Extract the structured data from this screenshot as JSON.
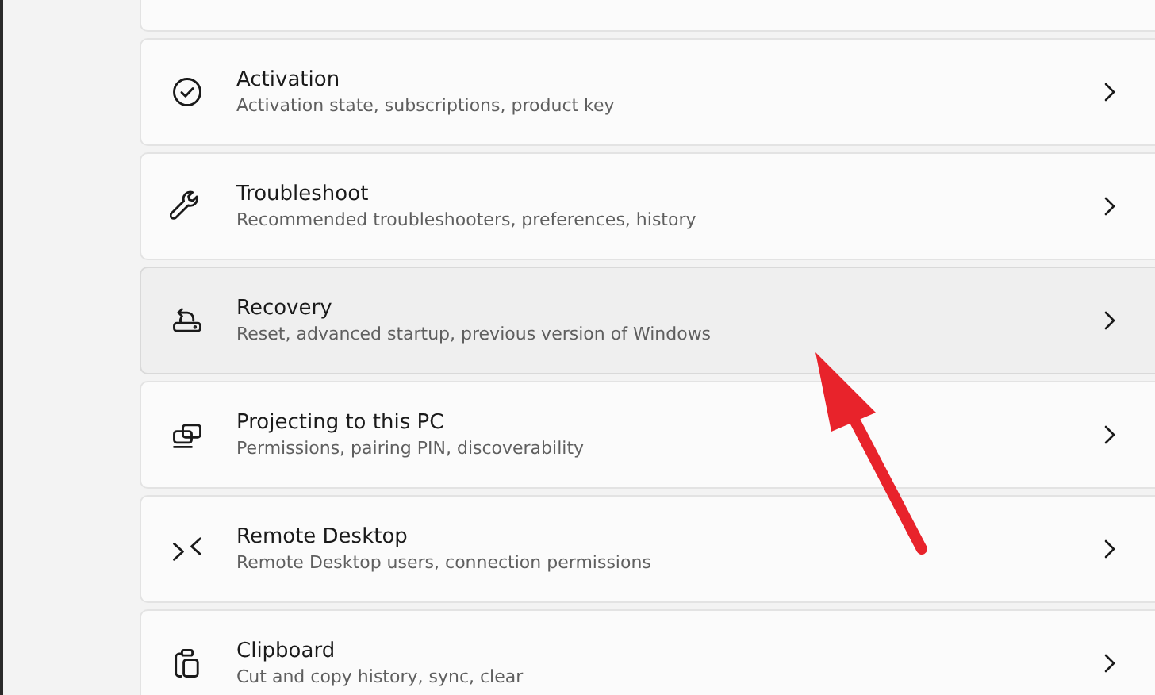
{
  "items": [
    {
      "kind": "activation",
      "title": "Activation",
      "subtitle": "Activation state, subscriptions, product key",
      "highlighted": false
    },
    {
      "kind": "troubleshoot",
      "title": "Troubleshoot",
      "subtitle": "Recommended troubleshooters, preferences, history",
      "highlighted": false
    },
    {
      "kind": "recovery",
      "title": "Recovery",
      "subtitle": "Reset, advanced startup, previous version of Windows",
      "highlighted": true
    },
    {
      "kind": "projecting",
      "title": "Projecting to this PC",
      "subtitle": "Permissions, pairing PIN, discoverability",
      "highlighted": false
    },
    {
      "kind": "remote",
      "title": "Remote Desktop",
      "subtitle": "Remote Desktop users, connection permissions",
      "highlighted": false
    },
    {
      "kind": "clipboard",
      "title": "Clipboard",
      "subtitle": "Cut and copy history, sync, clear",
      "highlighted": false
    }
  ]
}
